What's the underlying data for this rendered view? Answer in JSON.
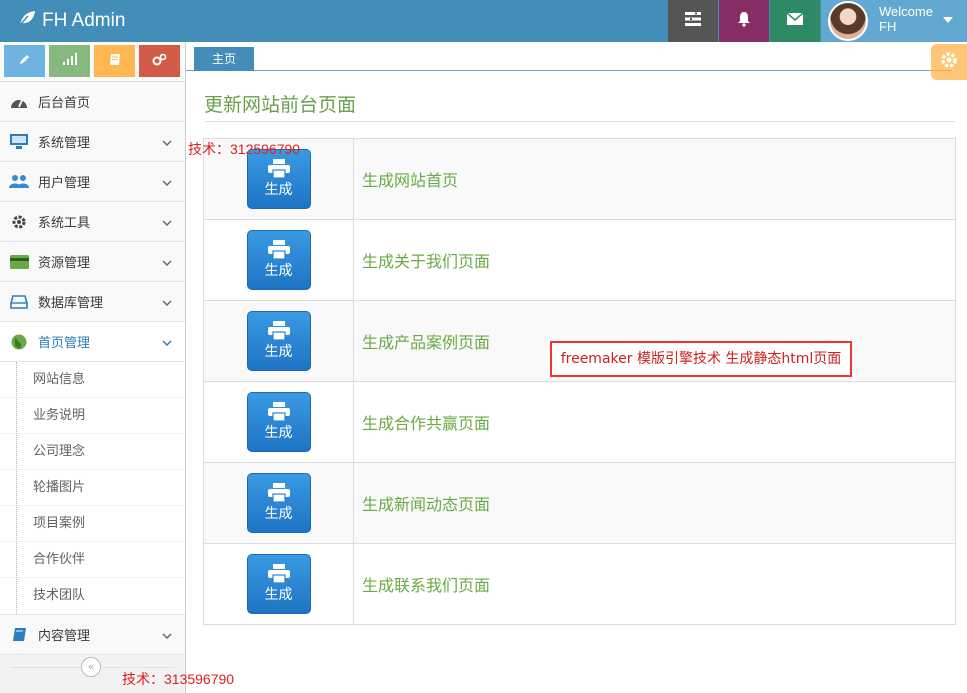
{
  "app": {
    "brand": "FH Admin"
  },
  "header": {
    "welcome": "Welcome",
    "username": "FH"
  },
  "sidebar": {
    "items": [
      {
        "label": "后台首页",
        "icon": "dashboard-icon"
      },
      {
        "label": "系统管理",
        "icon": "desktop-icon"
      },
      {
        "label": "用户管理",
        "icon": "users-icon"
      },
      {
        "label": "系统工具",
        "icon": "cog-icon"
      },
      {
        "label": "资源管理",
        "icon": "credit-card-icon"
      },
      {
        "label": "数据库管理",
        "icon": "hdd-icon"
      },
      {
        "label": "首页管理",
        "icon": "globe-icon",
        "active": true
      },
      {
        "label": "内容管理",
        "icon": "book-icon"
      }
    ],
    "subitems": [
      "网站信息",
      "业务说明",
      "公司理念",
      "轮播图片",
      "项目案例",
      "合作伙伴",
      "技术团队"
    ]
  },
  "tabs": [
    {
      "label": "主页"
    }
  ],
  "main": {
    "title": "更新网站前台页面",
    "button_label": "生成",
    "rows": [
      "生成网站首页",
      "生成关于我们页面",
      "生成产品案例页面",
      "生成合作共赢页面",
      "生成新闻动态页面",
      "生成联系我们页面"
    ]
  },
  "watermarks": {
    "top": "技术：312596790",
    "bottom": "技术：313596790"
  },
  "annotation": "freemaker 模版引擎技术 生成静态html页面",
  "colors": {
    "navbar": "#438eb9",
    "accent_green": "#69aa46",
    "button_blue": "#2b84d3",
    "annotation_red": "#e33333"
  }
}
